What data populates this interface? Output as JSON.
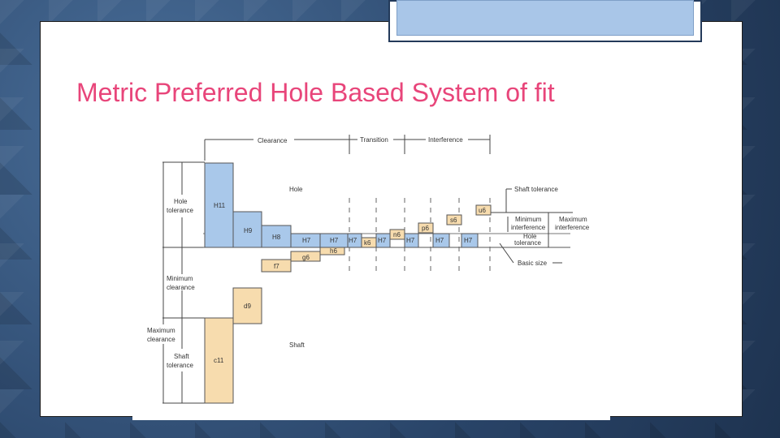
{
  "slide": {
    "title": "Metric Preferred Hole Based System of fit"
  },
  "diagram": {
    "categories": {
      "clearance": "Clearance",
      "transition": "Transition",
      "interference": "Interference"
    },
    "labels": {
      "hole": "Hole",
      "shaft": "Shaft",
      "hole_tolerance_left_1": "Hole",
      "hole_tolerance_left_2": "tolerance",
      "minimum_clearance_1": "Minimum",
      "minimum_clearance_2": "clearance",
      "maximum_clearance_1": "Maximum",
      "maximum_clearance_2": "clearance",
      "shaft_tolerance_left_1": "Shaft",
      "shaft_tolerance_left_2": "tolerance",
      "shaft_tolerance_right": "Shaft tolerance",
      "minimum_interference_1": "Minimum",
      "minimum_interference_2": "interference",
      "maximum_interference_1": "Maximum",
      "maximum_interference_2": "interference",
      "hole_tolerance_right_1": "Hole",
      "hole_tolerance_right_2": "tolerance",
      "basic_size": "Basic size"
    },
    "hole_grades": [
      "H11",
      "H9",
      "H8",
      "H7",
      "H7",
      "H7",
      "H7",
      "H7",
      "H7",
      "H7"
    ],
    "shaft_grades": [
      "c11",
      "d9",
      "f7",
      "g6",
      "h6",
      "k6",
      "n6",
      "p6",
      "s6",
      "u6"
    ],
    "colors": {
      "hole_fill": "#a9c8ea",
      "shaft_fill": "#f7dcae",
      "line": "#444444"
    }
  }
}
